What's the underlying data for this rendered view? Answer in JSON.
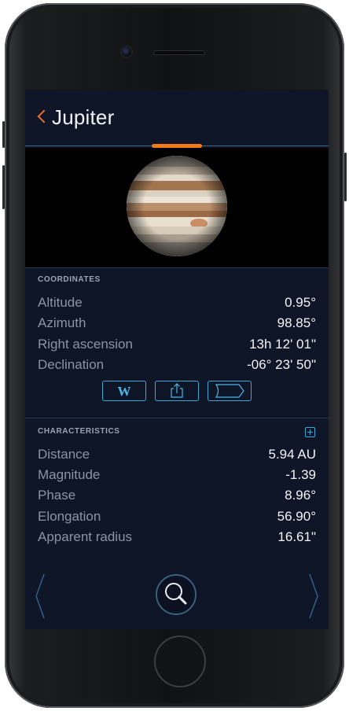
{
  "header": {
    "title": "Jupiter"
  },
  "image": {
    "subject": "Jupiter"
  },
  "coordinates": {
    "section_title": "COORDINATES",
    "rows": [
      {
        "label": "Altitude",
        "value": "0.95°"
      },
      {
        "label": "Azimuth",
        "value": "98.85°"
      },
      {
        "label": "Right ascension",
        "value": "13h 12' 01\""
      },
      {
        "label": "Declination",
        "value": "-06° 23' 50\""
      }
    ],
    "actions": {
      "wikipedia_label": "W",
      "share_icon": "share-icon",
      "tag_icon": "tag-icon"
    }
  },
  "characteristics": {
    "section_title": "CHARACTERISTICS",
    "add_icon": "plus-icon",
    "rows": [
      {
        "label": "Distance",
        "value": "5.94 AU"
      },
      {
        "label": "Magnitude",
        "value": "-1.39"
      },
      {
        "label": "Phase",
        "value": "8.96°"
      },
      {
        "label": "Elongation",
        "value": "56.90°"
      },
      {
        "label": "Apparent radius",
        "value": "16.61\""
      }
    ]
  },
  "bottom_nav": {
    "prev_icon": "chevron-left-icon",
    "search_icon": "search-icon",
    "next_icon": "chevron-right-icon"
  },
  "colors": {
    "screen_bg": "#0e1526",
    "accent_orange": "#f07a18",
    "accent_blue": "#3aa7d8",
    "label_gray": "#8c93a1",
    "value_white": "#f3f4f7"
  }
}
